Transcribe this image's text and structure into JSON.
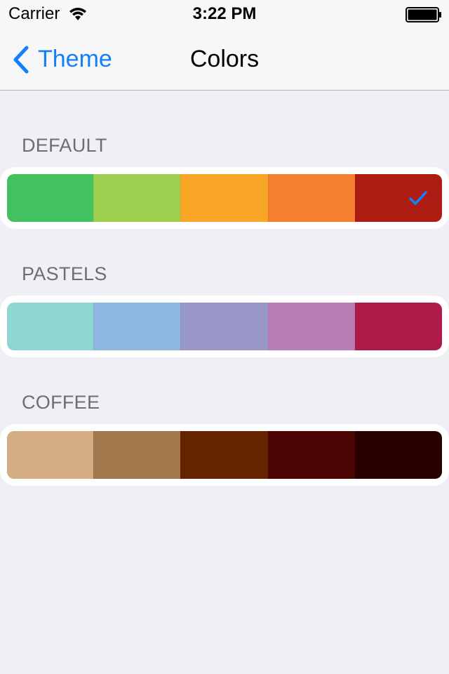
{
  "status_bar": {
    "carrier": "Carrier",
    "time": "3:22 PM"
  },
  "nav": {
    "back_label": "Theme",
    "title": "Colors",
    "tint": "#157efb"
  },
  "palettes": [
    {
      "header": "DEFAULT",
      "selected": true,
      "colors": [
        "#43c15e",
        "#9ecf51",
        "#f9a626",
        "#f67f30",
        "#ad1c13"
      ]
    },
    {
      "header": "PASTELS",
      "selected": false,
      "colors": [
        "#8dd6d2",
        "#8db6e0",
        "#9997c8",
        "#b97db6",
        "#ae1b48"
      ]
    },
    {
      "header": "COFFEE",
      "selected": false,
      "colors": [
        "#d3ae82",
        "#a1784b",
        "#642400",
        "#4a0402",
        "#290000"
      ]
    }
  ],
  "checkmark_color": "#157efb"
}
